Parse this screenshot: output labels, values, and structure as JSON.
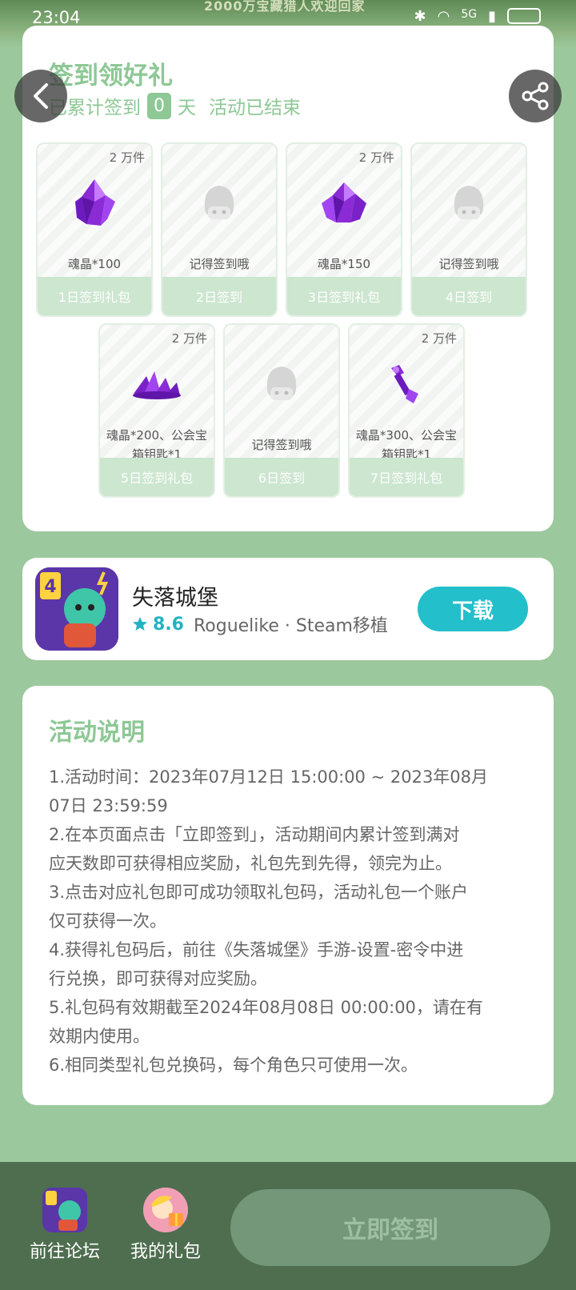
{
  "status_bar": {
    "time": "23:04",
    "network": "5G"
  },
  "banner": {
    "text": "2000万宝藏猎人欢迎回家"
  },
  "signin": {
    "title": "签到领好礼",
    "prefix": "已累计签到",
    "count": "0",
    "unit": "天",
    "status": "活动已结束",
    "gifts": [
      {
        "qty": "2 万件",
        "name": "魂晶*100",
        "day": "1日签到礼包",
        "icon": "crystal-icon"
      },
      {
        "qty": "",
        "name": "记得签到哦",
        "day": "2日签到",
        "icon": "placeholder-mascot-icon"
      },
      {
        "qty": "2 万件",
        "name": "魂晶*150",
        "day": "3日签到礼包",
        "icon": "crystal-icon"
      },
      {
        "qty": "",
        "name": "记得签到哦",
        "day": "4日签到",
        "icon": "placeholder-mascot-icon"
      },
      {
        "qty": "2 万件",
        "name": "魂晶*200、公会宝箱钥匙*1",
        "day": "5日签到礼包",
        "icon": "crystal-pile-icon"
      },
      {
        "qty": "",
        "name": "记得签到哦",
        "day": "6日签到",
        "icon": "placeholder-mascot-icon"
      },
      {
        "qty": "2 万件",
        "name": "魂晶*300、公会宝箱钥匙*1",
        "day": "7日签到礼包",
        "icon": "key-icon"
      }
    ]
  },
  "game": {
    "name": "失落城堡",
    "rating": "8.6",
    "tags": "Roguelike · Steam移植",
    "download_label": "下载",
    "icon": "game-app-icon"
  },
  "description": {
    "title": "活动说明",
    "lines": [
      "1.活动时间：2023年07月12日 15:00:00 ~ 2023年08月",
      "07日 23:59:59",
      "2.在本页面点击「立即签到」，活动期间内累计签到满对",
      "应天数即可获得相应奖励，礼包先到先得，领完为止。",
      "3.点击对应礼包即可成功领取礼包码，活动礼包一个账户",
      "仅可获得一次。",
      "4.获得礼包码后，前往《失落城堡》手游-设置-密令中进",
      "行兑换，即可获得对应奖励。",
      "5.礼包码有效期截至2024年08月08日 00:00:00，请在有",
      "效期内使用。",
      "6.相同类型礼包兑换码，每个角色只可使用一次。"
    ]
  },
  "bottom_bar": {
    "forum_label": "前往论坛",
    "gifts_label": "我的礼包",
    "signin_label": "立即签到"
  },
  "colors": {
    "accent": "#8dc895",
    "background": "#9cc89d",
    "download": "#23bfca",
    "bottom_bar": "#4e6e4f"
  }
}
